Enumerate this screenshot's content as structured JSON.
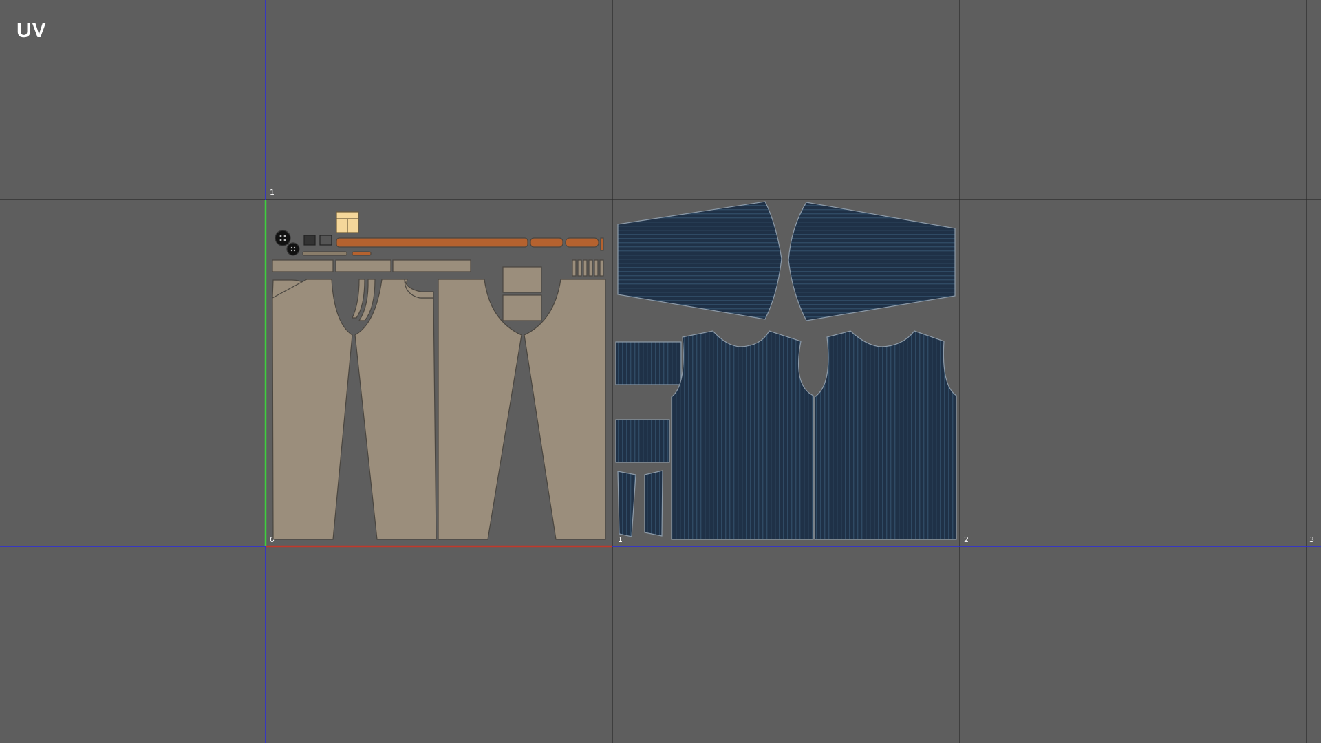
{
  "viewport": {
    "title": "UV",
    "background": "#5e5e5e",
    "grid_line_color": "#2a2a2a",
    "u_axis_color": "#2a2ae0",
    "v_axis_color": "#2a2ae0",
    "u_unit_color": "#c0392b",
    "v_unit_color": "#3ecf3e"
  },
  "axes": {
    "origin_label": "0",
    "u_ticks": [
      "1",
      "2",
      "3"
    ],
    "v_ticks": [
      "1"
    ]
  },
  "uv_tiles": [
    {
      "id": "pants",
      "fill_color": "#9b8e7c",
      "accent_color": "#b5622f",
      "label_color": "#f5d79a"
    },
    {
      "id": "vest",
      "fill_color": "#1f3147",
      "stripe_color": "#2c4660"
    }
  ],
  "icons": {
    "button_icon": "black-circle-with-four-holes"
  }
}
